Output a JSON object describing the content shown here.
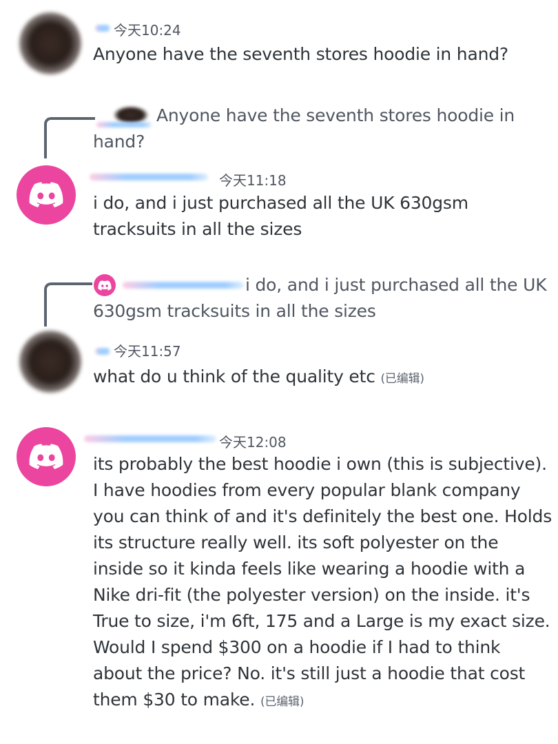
{
  "messages": [
    {
      "timestamp": "今天10:24",
      "text": "Anyone have the seventh stores hoodie in hand?"
    },
    {
      "reply_preview": "Anyone have the seventh stores hoodie in hand?",
      "timestamp": "今天11:18",
      "text_lines": [
        "i do, and i just purchased all the UK 630gsm",
        "tracksuits in all the sizes"
      ]
    },
    {
      "reply_preview_line1": "i do, and i just purchased all the UK",
      "reply_preview_line2": "630gsm tracksuits in all the sizes",
      "timestamp": "今天11:57",
      "text": "what do u think of the quality etc",
      "edited": "(已编辑)"
    },
    {
      "timestamp": "今天12:08",
      "text_lines": [
        "its probably the best hoodie i own (this is subjective).",
        "I have hoodies from every popular blank company",
        "you can think of and it's definitely the best one. Holds",
        "its structure really well. its soft polyester on the",
        "inside so it kinda feels like wearing a hoodie with a",
        "Nike dri-fit (the polyester version) on the inside. it's",
        "True to size, i'm 6ft, 175 and a Large is my exact size.",
        "Would I spend $300 on a hoodie if I had to think",
        "about the price? No. it's still just a hoodie that cost",
        "them $30 to make."
      ],
      "edited": "(已编辑)"
    }
  ],
  "colors": {
    "discord_pink": "#eb459f",
    "text": "#2e3338",
    "muted": "#4f5660"
  },
  "icons": {
    "avatar": "discord-logo-icon"
  }
}
